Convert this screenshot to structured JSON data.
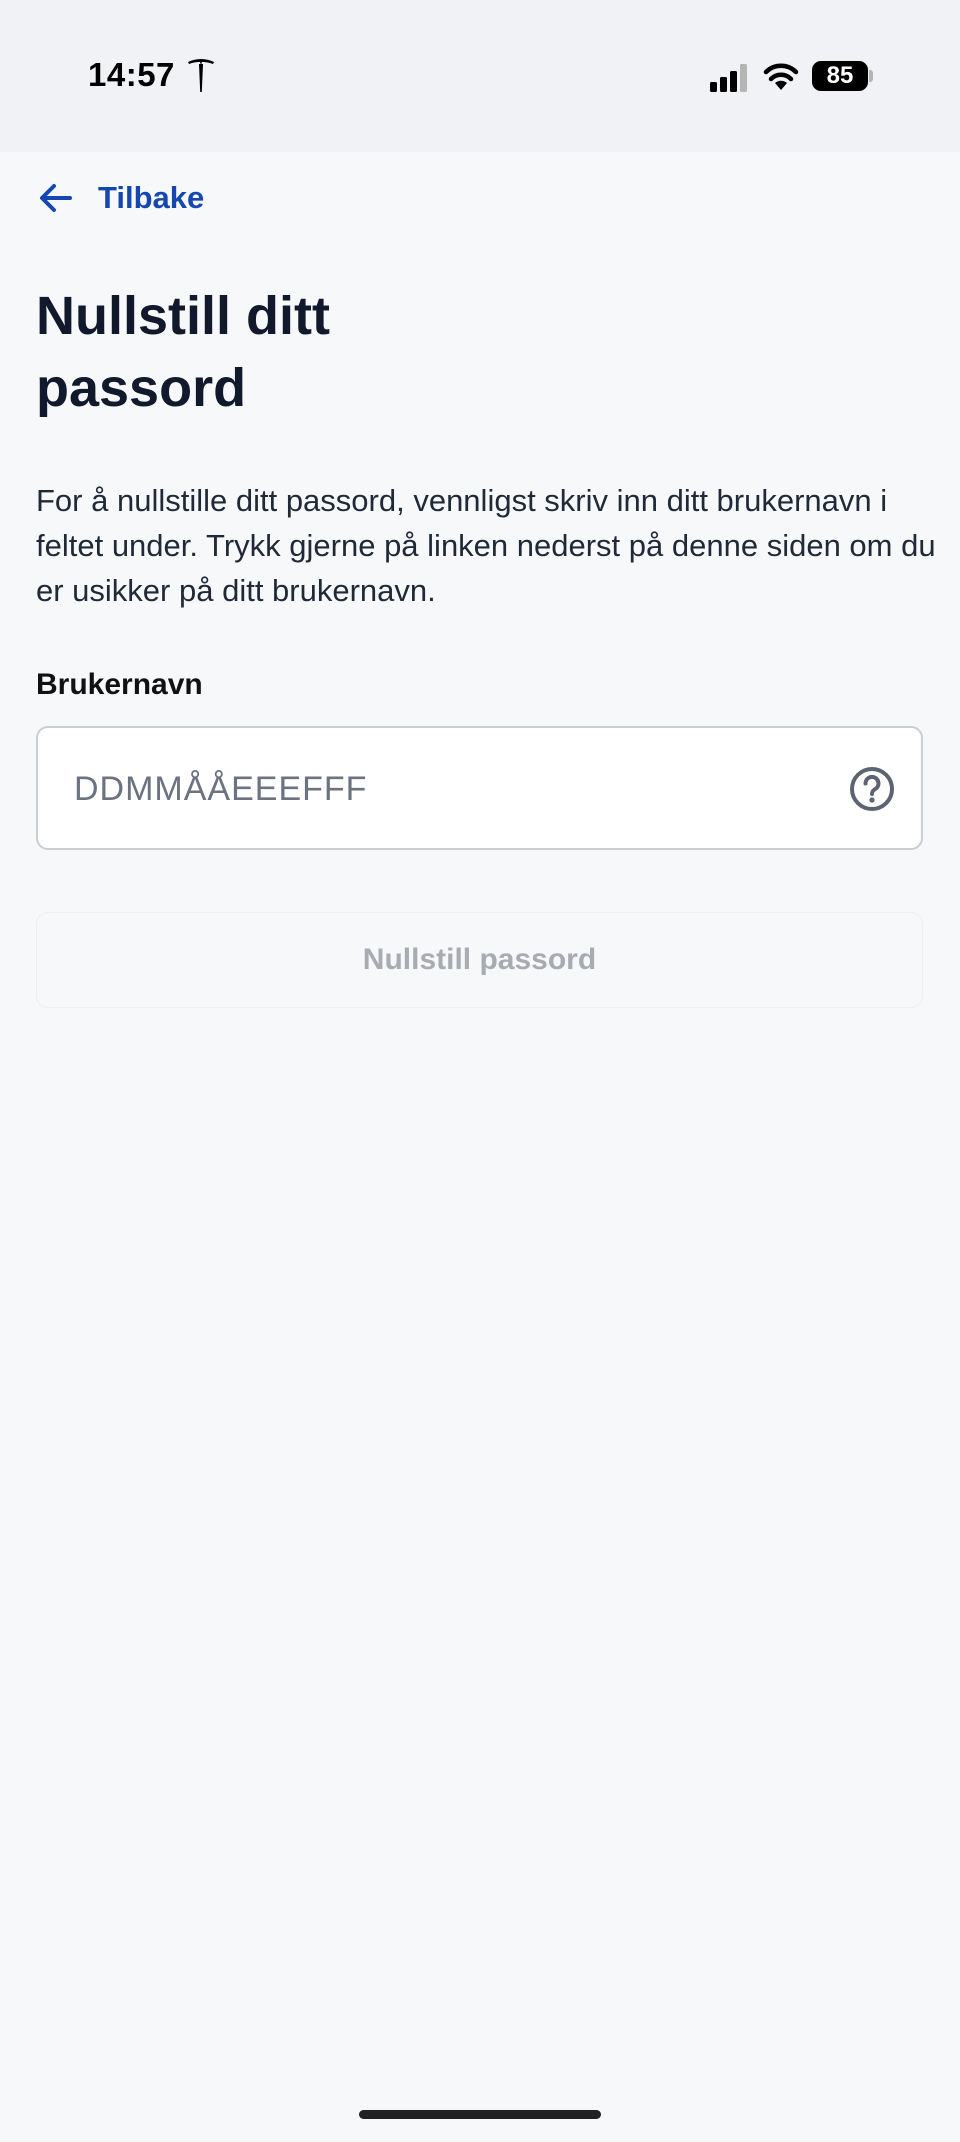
{
  "status_bar": {
    "time": "14:57",
    "battery": "85",
    "icons": [
      "tesla-icon",
      "cellular-signal-icon",
      "wifi-icon",
      "battery-icon"
    ]
  },
  "nav": {
    "back_label": "Tilbake",
    "back_icon": "arrow-left-icon"
  },
  "page": {
    "title": "Nullstill ditt passord",
    "description": "For å nullstille ditt passord, vennligst skriv inn ditt brukernavn i feltet under. Trykk gjerne på linken nederst på denne siden om du er usikker på ditt brukernavn."
  },
  "form": {
    "username_label": "Brukernavn",
    "username_value": "",
    "username_placeholder": "DDMMÅÅEEEFFF",
    "help_icon": "question-circle-icon",
    "submit_label": "Nullstill passord",
    "submit_enabled": false
  },
  "colors": {
    "accent": "#1646b0",
    "title": "#111a2c",
    "background": "#f7f8fa",
    "disabled_text": "#a8abb2"
  }
}
